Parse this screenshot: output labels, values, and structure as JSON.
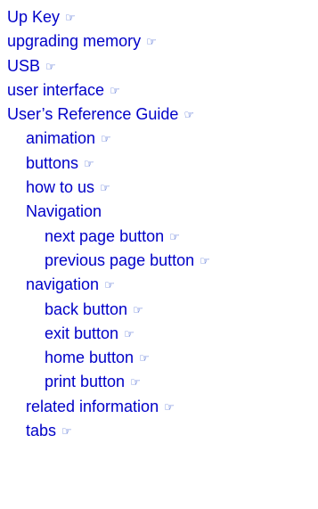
{
  "index": {
    "entries": [
      {
        "label": "Up Key",
        "level": 0,
        "link": true
      },
      {
        "label": "upgrading memory",
        "level": 0,
        "link": true
      },
      {
        "label": "USB",
        "level": 0,
        "link": true
      },
      {
        "label": "user interface",
        "level": 0,
        "link": true
      },
      {
        "label": "User’s Reference Guide",
        "level": 0,
        "link": true
      },
      {
        "label": "animation",
        "level": 1,
        "link": true
      },
      {
        "label": "buttons",
        "level": 1,
        "link": true
      },
      {
        "label": "how to us",
        "level": 1,
        "link": true
      },
      {
        "label": "Navigation",
        "level": 1,
        "link": false
      },
      {
        "label": "next page button",
        "level": 2,
        "link": true
      },
      {
        "label": "previous page button",
        "level": 2,
        "link": true
      },
      {
        "label": "navigation",
        "level": 1,
        "link": true
      },
      {
        "label": "back button",
        "level": 2,
        "link": true
      },
      {
        "label": "exit button",
        "level": 2,
        "link": true
      },
      {
        "label": "home button",
        "level": 2,
        "link": true
      },
      {
        "label": "print button",
        "level": 2,
        "link": true
      },
      {
        "label": "related information",
        "level": 1,
        "link": true
      },
      {
        "label": "tabs",
        "level": 1,
        "link": true
      }
    ],
    "link_icon": "pointing-hand-icon",
    "link_color": "#0000c8"
  }
}
